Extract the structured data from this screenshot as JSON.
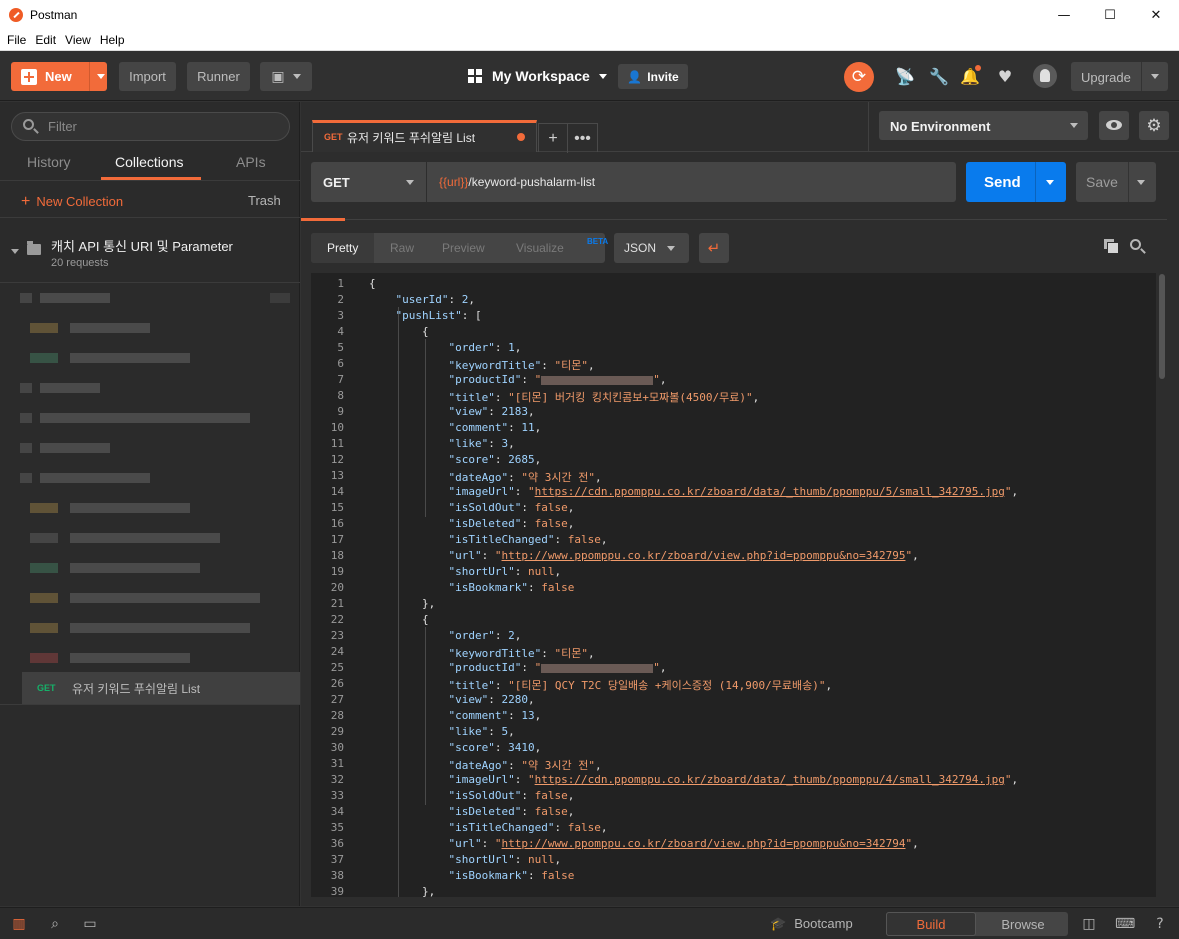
{
  "window": {
    "title": "Postman",
    "minimize": "—",
    "maximize": "☐",
    "close": "✕"
  },
  "menu": [
    "File",
    "Edit",
    "View",
    "Help"
  ],
  "header": {
    "new_label": "New",
    "import_label": "Import",
    "runner_label": "Runner",
    "workspace_label": "My Workspace",
    "invite_label": "Invite",
    "upgrade_label": "Upgrade"
  },
  "sidebar": {
    "filter_placeholder": "Filter",
    "tabs": [
      "History",
      "Collections",
      "APIs"
    ],
    "active_tab": "Collections",
    "new_collection_label": "New Collection",
    "trash_label": "Trash",
    "collection": {
      "name": "캐치 API 통신 URI 및 Parameter",
      "count": "20 requests"
    },
    "active_request": {
      "method": "GET",
      "name": "유저 키워드 푸쉬알림 List"
    }
  },
  "request_tab": {
    "method": "GET",
    "name": "유저 키워드 푸쉬알림 List"
  },
  "environment": {
    "selected": "No Environment"
  },
  "request": {
    "method": "GET",
    "url_variable": "{{url}}",
    "url_path": "/keyword-pushalarm-list",
    "send_label": "Send",
    "save_label": "Save"
  },
  "response": {
    "view_tabs": [
      "Pretty",
      "Raw",
      "Preview",
      "Visualize"
    ],
    "active_view": "Pretty",
    "beta_label": "BETA",
    "format": "JSON"
  },
  "code": {
    "line_numbers": [
      "1",
      "2",
      "3",
      "4",
      "5",
      "6",
      "7",
      "8",
      "9",
      "10",
      "11",
      "12",
      "13",
      "14",
      "15",
      "16",
      "17",
      "18",
      "19",
      "20",
      "21",
      "22",
      "23",
      "24",
      "25",
      "26",
      "27",
      "28",
      "29",
      "30",
      "31",
      "32",
      "33",
      "34",
      "35",
      "36",
      "37",
      "38",
      "39"
    ],
    "items": [
      {
        "order": "1",
        "keywordTitle": "\"티몬\"",
        "title": "\"[티몬] 버거킹 킹치킨콤보+모짜볼(4500/무료)\"",
        "view": "2183",
        "comment": "11",
        "like": "3",
        "score": "2685",
        "dateAgo": "\"약 3시간 전\"",
        "imageUrl": "https://cdn.ppomppu.co.kr/zboard/data/_thumb/ppomppu/5/small_342795.jpg",
        "isSoldOut": "false",
        "isDeleted": "false",
        "isTitleChanged": "false",
        "url": "http://www.ppomppu.co.kr/zboard/view.php?id=ppomppu&no=342795",
        "shortUrl": "null",
        "isBookmark": "false"
      },
      {
        "order": "2",
        "keywordTitle": "\"티몬\"",
        "title": "\"[티몬] QCY T2C 당일배송 +케이스증정 (14,900/무료배송)\"",
        "view": "2280",
        "comment": "13",
        "like": "5",
        "score": "3410",
        "dateAgo": "\"약 3시간 전\"",
        "imageUrl": "https://cdn.ppomppu.co.kr/zboard/data/_thumb/ppomppu/4/small_342794.jpg",
        "isSoldOut": "false",
        "isDeleted": "false",
        "isTitleChanged": "false",
        "url": "http://www.ppomppu.co.kr/zboard/view.php?id=ppomppu&no=342794",
        "shortUrl": "null",
        "isBookmark": "false"
      }
    ],
    "userId": "2"
  },
  "footer": {
    "bootcamp_label": "Bootcamp",
    "build_label": "Build",
    "browse_label": "Browse"
  },
  "colors": {
    "accent": "#f26b3a",
    "send": "#097bed",
    "get_method": "#16b069"
  },
  "icons": [
    "sync-icon",
    "satellite-icon",
    "wrench-icon",
    "bell-icon",
    "heart-icon",
    "avatar-icon",
    "eye-icon",
    "gear-icon",
    "copy-icon",
    "search-icon",
    "sidebar-toggle-icon",
    "find-icon",
    "console-icon",
    "two-pane-icon",
    "keyboard-icon",
    "help-icon"
  ]
}
